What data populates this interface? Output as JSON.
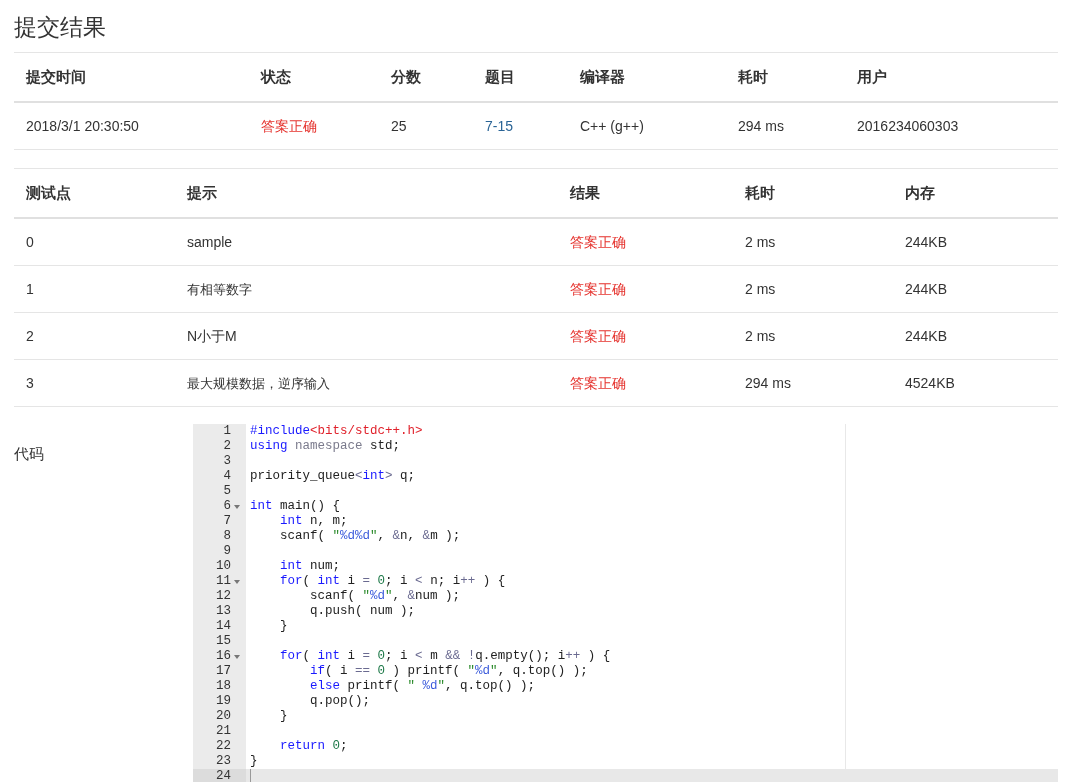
{
  "title": "提交结果",
  "summary": {
    "columns": [
      "提交时间",
      "状态",
      "分数",
      "题目",
      "编译器",
      "耗时",
      "用户"
    ],
    "rows": [
      [
        {
          "kind": "text",
          "text": "2018/3/1 20:30:50"
        },
        {
          "kind": "status",
          "text": "答案正确"
        },
        {
          "kind": "text",
          "text": "25"
        },
        {
          "kind": "link",
          "text": "7-15"
        },
        {
          "kind": "text",
          "text": "C++ (g++)"
        },
        {
          "kind": "text",
          "text": "294 ms"
        },
        {
          "kind": "text",
          "text": "2016234060303"
        }
      ]
    ]
  },
  "tests": {
    "columns": [
      "测试点",
      "提示",
      "结果",
      "耗时",
      "内存"
    ],
    "rows": [
      [
        {
          "kind": "text",
          "text": "0"
        },
        {
          "kind": "text",
          "text": "sample"
        },
        {
          "kind": "status",
          "text": "答案正确"
        },
        {
          "kind": "text",
          "text": "2 ms"
        },
        {
          "kind": "text",
          "text": "244KB"
        }
      ],
      [
        {
          "kind": "text",
          "text": "1"
        },
        {
          "kind": "small",
          "text": "有相等数字"
        },
        {
          "kind": "status",
          "text": "答案正确"
        },
        {
          "kind": "text",
          "text": "2 ms"
        },
        {
          "kind": "text",
          "text": "244KB"
        }
      ],
      [
        {
          "kind": "text",
          "text": "2"
        },
        {
          "kind": "text",
          "text": "N小于M"
        },
        {
          "kind": "status",
          "text": "答案正确"
        },
        {
          "kind": "text",
          "text": "2 ms"
        },
        {
          "kind": "text",
          "text": "244KB"
        }
      ],
      [
        {
          "kind": "text",
          "text": "3"
        },
        {
          "kind": "small",
          "text": "最大规模数据，逆序输入"
        },
        {
          "kind": "status",
          "text": "答案正确"
        },
        {
          "kind": "text",
          "text": "294 ms"
        },
        {
          "kind": "text",
          "text": "4524KB"
        }
      ]
    ]
  },
  "code": {
    "label": "代码",
    "lines": [
      {
        "number": "1",
        "foldable": false,
        "active": false,
        "tokens": [
          {
            "kind": "meta",
            "text": "#include"
          },
          {
            "kind": "inc",
            "text": "<bits/stdc++.h>"
          }
        ]
      },
      {
        "number": "2",
        "foldable": false,
        "active": false,
        "tokens": [
          {
            "kind": "kw",
            "text": "using "
          },
          {
            "kind": "ns",
            "text": "namespace"
          },
          {
            "kind": "plain",
            "text": " std;"
          }
        ]
      },
      {
        "number": "3",
        "foldable": false,
        "active": false
      },
      {
        "number": "4",
        "foldable": false,
        "active": false,
        "tokens": [
          {
            "kind": "plain",
            "text": "priority_queue"
          },
          {
            "kind": "op",
            "text": "<"
          },
          {
            "kind": "kw",
            "text": "int"
          },
          {
            "kind": "op",
            "text": ">"
          },
          {
            "kind": "plain",
            "text": " q;"
          }
        ]
      },
      {
        "number": "5",
        "foldable": false,
        "active": false
      },
      {
        "number": "6",
        "foldable": true,
        "active": false,
        "tokens": [
          {
            "kind": "kw",
            "text": "int"
          },
          {
            "kind": "plain",
            "text": " main() {"
          }
        ]
      },
      {
        "number": "7",
        "foldable": false,
        "active": false,
        "tokens": [
          {
            "kind": "kw",
            "text": "    int"
          },
          {
            "kind": "plain",
            "text": " n, m;"
          }
        ]
      },
      {
        "number": "8",
        "foldable": false,
        "active": false,
        "tokens": [
          {
            "kind": "plain",
            "text": "    scanf( "
          },
          {
            "kind": "str",
            "text": "\""
          },
          {
            "kind": "fmt",
            "text": "%d%d"
          },
          {
            "kind": "str",
            "text": "\""
          },
          {
            "kind": "plain",
            "text": ", "
          },
          {
            "kind": "op",
            "text": "&"
          },
          {
            "kind": "plain",
            "text": "n, "
          },
          {
            "kind": "op",
            "text": "&"
          },
          {
            "kind": "plain",
            "text": "m );"
          }
        ]
      },
      {
        "number": "9",
        "foldable": false,
        "active": false
      },
      {
        "number": "10",
        "foldable": false,
        "active": false,
        "tokens": [
          {
            "kind": "kw",
            "text": "    int"
          },
          {
            "kind": "plain",
            "text": " num;"
          }
        ]
      },
      {
        "number": "11",
        "foldable": true,
        "active": false,
        "tokens": [
          {
            "kind": "kw",
            "text": "    for"
          },
          {
            "kind": "plain",
            "text": "( "
          },
          {
            "kind": "kw",
            "text": "int"
          },
          {
            "kind": "plain",
            "text": " i "
          },
          {
            "kind": "op",
            "text": "= "
          },
          {
            "kind": "num",
            "text": "0"
          },
          {
            "kind": "plain",
            "text": "; i "
          },
          {
            "kind": "op",
            "text": "<"
          },
          {
            "kind": "plain",
            "text": " n; i"
          },
          {
            "kind": "op",
            "text": "++"
          },
          {
            "kind": "plain",
            "text": " ) {"
          }
        ]
      },
      {
        "number": "12",
        "foldable": false,
        "active": false,
        "tokens": [
          {
            "kind": "plain",
            "text": "        scanf( "
          },
          {
            "kind": "str",
            "text": "\""
          },
          {
            "kind": "fmt",
            "text": "%d"
          },
          {
            "kind": "str",
            "text": "\""
          },
          {
            "kind": "plain",
            "text": ", "
          },
          {
            "kind": "op",
            "text": "&"
          },
          {
            "kind": "plain",
            "text": "num );"
          }
        ]
      },
      {
        "number": "13",
        "foldable": false,
        "active": false,
        "tokens": [
          {
            "kind": "plain",
            "text": "        q.push( num );"
          }
        ]
      },
      {
        "number": "14",
        "foldable": false,
        "active": false,
        "tokens": [
          {
            "kind": "plain",
            "text": "    }"
          }
        ]
      },
      {
        "number": "15",
        "foldable": false,
        "active": false
      },
      {
        "number": "16",
        "foldable": true,
        "active": false,
        "tokens": [
          {
            "kind": "kw",
            "text": "    for"
          },
          {
            "kind": "plain",
            "text": "( "
          },
          {
            "kind": "kw",
            "text": "int"
          },
          {
            "kind": "plain",
            "text": " i "
          },
          {
            "kind": "op",
            "text": "= "
          },
          {
            "kind": "num",
            "text": "0"
          },
          {
            "kind": "plain",
            "text": "; i "
          },
          {
            "kind": "op",
            "text": "<"
          },
          {
            "kind": "plain",
            "text": " m "
          },
          {
            "kind": "op",
            "text": "&& !"
          },
          {
            "kind": "plain",
            "text": "q.empty(); i"
          },
          {
            "kind": "op",
            "text": "++"
          },
          {
            "kind": "plain",
            "text": " ) {"
          }
        ]
      },
      {
        "number": "17",
        "foldable": false,
        "active": false,
        "tokens": [
          {
            "kind": "kw",
            "text": "        if"
          },
          {
            "kind": "plain",
            "text": "( i "
          },
          {
            "kind": "op",
            "text": "== "
          },
          {
            "kind": "num",
            "text": "0"
          },
          {
            "kind": "plain",
            "text": " ) printf( "
          },
          {
            "kind": "str",
            "text": "\""
          },
          {
            "kind": "fmt",
            "text": "%d"
          },
          {
            "kind": "str",
            "text": "\""
          },
          {
            "kind": "plain",
            "text": ", q.top() );"
          }
        ]
      },
      {
        "number": "18",
        "foldable": false,
        "active": false,
        "tokens": [
          {
            "kind": "kw",
            "text": "        else"
          },
          {
            "kind": "plain",
            "text": " printf( "
          },
          {
            "kind": "str",
            "text": "\" "
          },
          {
            "kind": "fmt",
            "text": "%d"
          },
          {
            "kind": "str",
            "text": "\""
          },
          {
            "kind": "plain",
            "text": ", q.top() );"
          }
        ]
      },
      {
        "number": "19",
        "foldable": false,
        "active": false,
        "tokens": [
          {
            "kind": "plain",
            "text": "        q.pop();"
          }
        ]
      },
      {
        "number": "20",
        "foldable": false,
        "active": false,
        "tokens": [
          {
            "kind": "plain",
            "text": "    }"
          }
        ]
      },
      {
        "number": "21",
        "foldable": false,
        "active": false
      },
      {
        "number": "22",
        "foldable": false,
        "active": false,
        "tokens": [
          {
            "kind": "kw",
            "text": "    return "
          },
          {
            "kind": "num",
            "text": "0"
          },
          {
            "kind": "plain",
            "text": ";"
          }
        ]
      },
      {
        "number": "23",
        "foldable": false,
        "active": false,
        "tokens": [
          {
            "kind": "plain",
            "text": "}"
          }
        ]
      },
      {
        "number": "24",
        "foldable": false,
        "active": true
      }
    ]
  }
}
